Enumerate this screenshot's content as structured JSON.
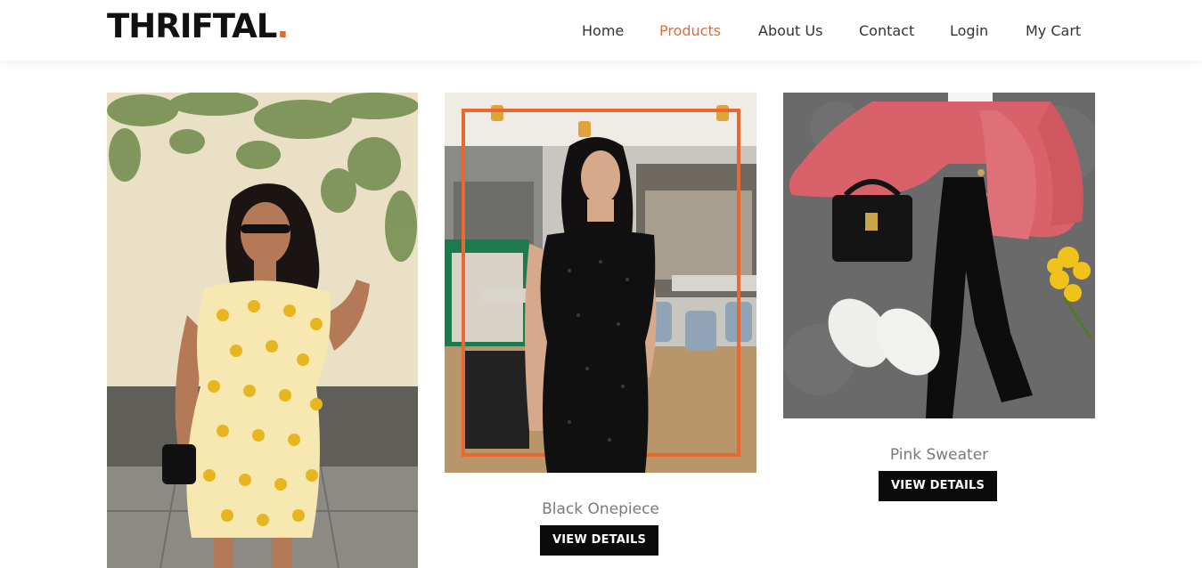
{
  "brand": {
    "name": "THRIFTAL",
    "dot": ".",
    "accent_color": "#e9682f"
  },
  "nav": {
    "items": [
      {
        "label": "Home"
      },
      {
        "label": "Products",
        "active": true
      },
      {
        "label": "About Us"
      },
      {
        "label": "Contact"
      },
      {
        "label": "Login"
      },
      {
        "label": "My Cart"
      }
    ]
  },
  "products": [
    {
      "title": "",
      "image": "woman in yellow sunflower dress"
    },
    {
      "title": "Black Onepiece",
      "button": "VIEW DETAILS",
      "image": "woman in black sequin dress in cafe"
    },
    {
      "title": "Pink Sweater",
      "button": "VIEW DETAILS",
      "image": "pink cardigan outfit flat lay"
    }
  ]
}
